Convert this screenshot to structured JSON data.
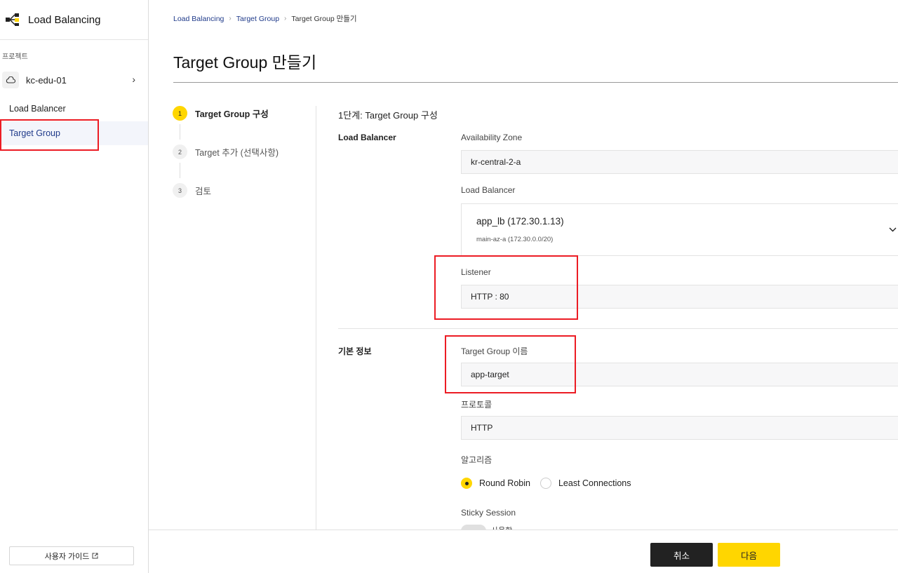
{
  "sidebar": {
    "app_title": "Load Balancing",
    "section_label": "프로젝트",
    "project_name": "kc-edu-01",
    "nav": [
      {
        "label": "Load Balancer"
      },
      {
        "label": "Target Group"
      }
    ],
    "guide_label": "사용자 가이드"
  },
  "breadcrumb": [
    "Load Balancing",
    "Target Group",
    "Target Group 만들기"
  ],
  "page_title": "Target Group 만들기",
  "steps": [
    {
      "number": "1",
      "label": "Target Group 구성"
    },
    {
      "number": "2",
      "label": "Target 추가 (선택사항)"
    },
    {
      "number": "3",
      "label": "검토"
    }
  ],
  "form": {
    "heading": "1단계: Target Group 구성",
    "lb_section": "Load Balancer",
    "az_label": "Availability Zone",
    "az_value": "kr-central-2-a",
    "lb_label": "Load Balancer",
    "lb_name": "app_lb (172.30.1.13)",
    "lb_subnet": "main-az-a (172.30.0.0/20)",
    "listener_label": "Listener",
    "listener_value": "HTTP : 80",
    "basic_section": "기본 정보",
    "tg_name_label": "Target Group 이름",
    "tg_name_value": "app-target",
    "protocol_label": "프로토콜",
    "protocol_value": "HTTP",
    "algorithm_label": "알고리즘",
    "algo_round_robin": "Round Robin",
    "algo_least_conn": "Least Connections",
    "sticky_label": "Sticky Session",
    "sticky_text": "사용함"
  },
  "footer": {
    "cancel_label": "취소",
    "next_label": "다음"
  },
  "colors": {
    "accent": "#ffd600",
    "highlight": "#ec1c24",
    "link": "#1f3a8a"
  }
}
